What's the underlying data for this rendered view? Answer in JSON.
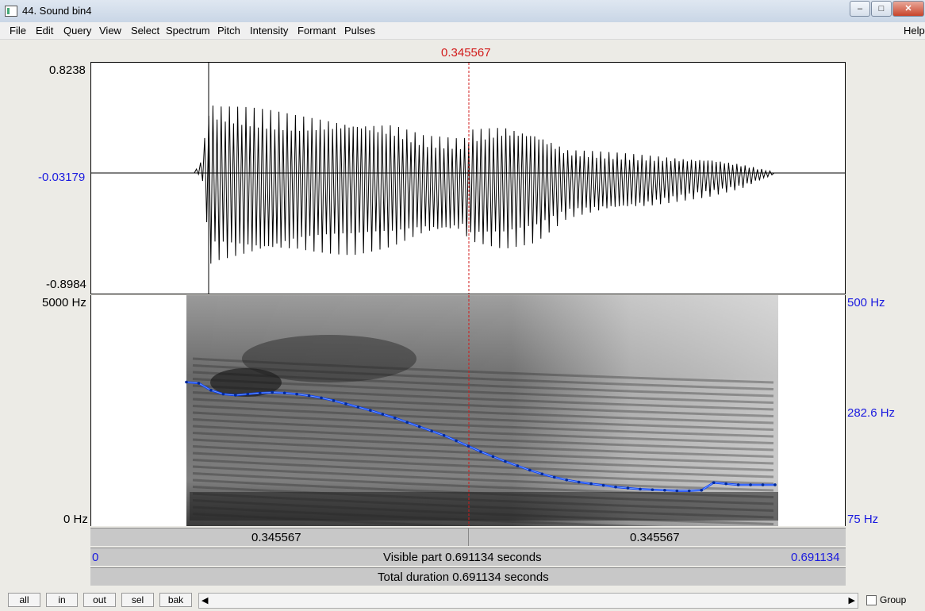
{
  "window": {
    "title": "44. Sound bin4",
    "minimize": "–",
    "maximize": "□",
    "close": "✕"
  },
  "menu": [
    "File",
    "Edit",
    "Query",
    "View",
    "Select",
    "Spectrum",
    "Pitch",
    "Intensity",
    "Formant",
    "Pulses",
    "Help"
  ],
  "cursor_time": "0.345567",
  "waveform": {
    "max": "0.8238",
    "zero": "-0.03179",
    "min": "-0.8984"
  },
  "spectrogram": {
    "freq_top": "5000 Hz",
    "freq_bottom": "0 Hz",
    "pitch_top": "500 Hz",
    "pitch_mid": "282.6 Hz",
    "pitch_bottom": "75 Hz",
    "pitch_curve_hz": [
      340,
      338,
      325,
      318,
      316,
      318,
      320,
      321,
      320,
      318,
      315,
      311,
      306,
      300,
      294,
      288,
      281,
      274,
      266,
      258,
      250,
      242,
      232,
      222,
      212,
      203,
      194,
      186,
      178,
      171,
      165,
      160,
      156,
      153,
      150,
      147,
      145,
      143,
      142,
      141,
      140,
      140,
      141,
      155,
      153,
      151,
      151,
      151,
      151
    ]
  },
  "time_bar": {
    "left_segment": "0.345567",
    "right_segment": "0.345567",
    "start": "0",
    "end": "0.691134",
    "visible": "Visible part 0.691134 seconds",
    "total": "Total duration 0.691134 seconds"
  },
  "buttons": {
    "all": "all",
    "in": "in",
    "out": "out",
    "sel": "sel",
    "bak": "bak"
  },
  "group_label": "Group",
  "colors": {
    "cursor": "#d21a1a",
    "pitch": "#0a3cff",
    "axis_text": "#1a1adf"
  }
}
